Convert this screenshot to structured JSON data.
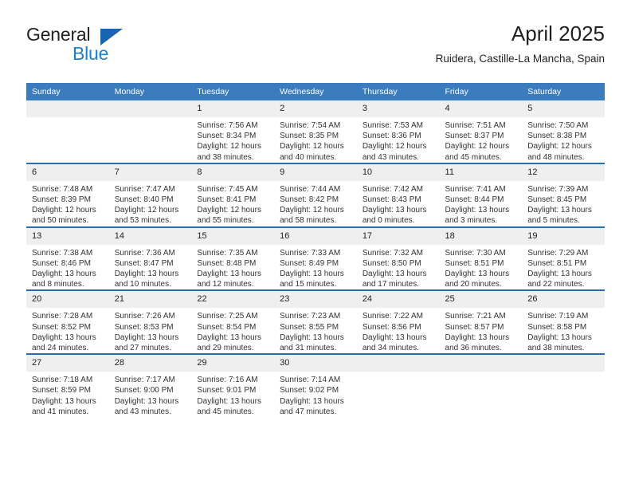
{
  "brand": {
    "line1": "General",
    "line2": "Blue",
    "triangle_icon": "triangle-logo-icon",
    "accent_dark": "#1565b0",
    "accent_light": "#1b7fd4"
  },
  "header": {
    "title": "April 2025",
    "subtitle": "Ruidera, Castille-La Mancha, Spain"
  },
  "theme": {
    "header_bar": "#3a7cbe",
    "week_separator": "#2b6cab",
    "daynum_band": "#efefef",
    "text": "#231f20"
  },
  "calendar": {
    "weekday_headers": [
      "Sunday",
      "Monday",
      "Tuesday",
      "Wednesday",
      "Thursday",
      "Friday",
      "Saturday"
    ],
    "weeks": [
      [
        {
          "day": "",
          "empty": true,
          "sunrise": "",
          "sunset": "",
          "daylight_1": "",
          "daylight_2": ""
        },
        {
          "day": "",
          "empty": true,
          "sunrise": "",
          "sunset": "",
          "daylight_1": "",
          "daylight_2": ""
        },
        {
          "day": "1",
          "empty": false,
          "sunrise": "Sunrise: 7:56 AM",
          "sunset": "Sunset: 8:34 PM",
          "daylight_1": "Daylight: 12 hours",
          "daylight_2": "and 38 minutes."
        },
        {
          "day": "2",
          "empty": false,
          "sunrise": "Sunrise: 7:54 AM",
          "sunset": "Sunset: 8:35 PM",
          "daylight_1": "Daylight: 12 hours",
          "daylight_2": "and 40 minutes."
        },
        {
          "day": "3",
          "empty": false,
          "sunrise": "Sunrise: 7:53 AM",
          "sunset": "Sunset: 8:36 PM",
          "daylight_1": "Daylight: 12 hours",
          "daylight_2": "and 43 minutes."
        },
        {
          "day": "4",
          "empty": false,
          "sunrise": "Sunrise: 7:51 AM",
          "sunset": "Sunset: 8:37 PM",
          "daylight_1": "Daylight: 12 hours",
          "daylight_2": "and 45 minutes."
        },
        {
          "day": "5",
          "empty": false,
          "sunrise": "Sunrise: 7:50 AM",
          "sunset": "Sunset: 8:38 PM",
          "daylight_1": "Daylight: 12 hours",
          "daylight_2": "and 48 minutes."
        }
      ],
      [
        {
          "day": "6",
          "empty": false,
          "sunrise": "Sunrise: 7:48 AM",
          "sunset": "Sunset: 8:39 PM",
          "daylight_1": "Daylight: 12 hours",
          "daylight_2": "and 50 minutes."
        },
        {
          "day": "7",
          "empty": false,
          "sunrise": "Sunrise: 7:47 AM",
          "sunset": "Sunset: 8:40 PM",
          "daylight_1": "Daylight: 12 hours",
          "daylight_2": "and 53 minutes."
        },
        {
          "day": "8",
          "empty": false,
          "sunrise": "Sunrise: 7:45 AM",
          "sunset": "Sunset: 8:41 PM",
          "daylight_1": "Daylight: 12 hours",
          "daylight_2": "and 55 minutes."
        },
        {
          "day": "9",
          "empty": false,
          "sunrise": "Sunrise: 7:44 AM",
          "sunset": "Sunset: 8:42 PM",
          "daylight_1": "Daylight: 12 hours",
          "daylight_2": "and 58 minutes."
        },
        {
          "day": "10",
          "empty": false,
          "sunrise": "Sunrise: 7:42 AM",
          "sunset": "Sunset: 8:43 PM",
          "daylight_1": "Daylight: 13 hours",
          "daylight_2": "and 0 minutes."
        },
        {
          "day": "11",
          "empty": false,
          "sunrise": "Sunrise: 7:41 AM",
          "sunset": "Sunset: 8:44 PM",
          "daylight_1": "Daylight: 13 hours",
          "daylight_2": "and 3 minutes."
        },
        {
          "day": "12",
          "empty": false,
          "sunrise": "Sunrise: 7:39 AM",
          "sunset": "Sunset: 8:45 PM",
          "daylight_1": "Daylight: 13 hours",
          "daylight_2": "and 5 minutes."
        }
      ],
      [
        {
          "day": "13",
          "empty": false,
          "sunrise": "Sunrise: 7:38 AM",
          "sunset": "Sunset: 8:46 PM",
          "daylight_1": "Daylight: 13 hours",
          "daylight_2": "and 8 minutes."
        },
        {
          "day": "14",
          "empty": false,
          "sunrise": "Sunrise: 7:36 AM",
          "sunset": "Sunset: 8:47 PM",
          "daylight_1": "Daylight: 13 hours",
          "daylight_2": "and 10 minutes."
        },
        {
          "day": "15",
          "empty": false,
          "sunrise": "Sunrise: 7:35 AM",
          "sunset": "Sunset: 8:48 PM",
          "daylight_1": "Daylight: 13 hours",
          "daylight_2": "and 12 minutes."
        },
        {
          "day": "16",
          "empty": false,
          "sunrise": "Sunrise: 7:33 AM",
          "sunset": "Sunset: 8:49 PM",
          "daylight_1": "Daylight: 13 hours",
          "daylight_2": "and 15 minutes."
        },
        {
          "day": "17",
          "empty": false,
          "sunrise": "Sunrise: 7:32 AM",
          "sunset": "Sunset: 8:50 PM",
          "daylight_1": "Daylight: 13 hours",
          "daylight_2": "and 17 minutes."
        },
        {
          "day": "18",
          "empty": false,
          "sunrise": "Sunrise: 7:30 AM",
          "sunset": "Sunset: 8:51 PM",
          "daylight_1": "Daylight: 13 hours",
          "daylight_2": "and 20 minutes."
        },
        {
          "day": "19",
          "empty": false,
          "sunrise": "Sunrise: 7:29 AM",
          "sunset": "Sunset: 8:51 PM",
          "daylight_1": "Daylight: 13 hours",
          "daylight_2": "and 22 minutes."
        }
      ],
      [
        {
          "day": "20",
          "empty": false,
          "sunrise": "Sunrise: 7:28 AM",
          "sunset": "Sunset: 8:52 PM",
          "daylight_1": "Daylight: 13 hours",
          "daylight_2": "and 24 minutes."
        },
        {
          "day": "21",
          "empty": false,
          "sunrise": "Sunrise: 7:26 AM",
          "sunset": "Sunset: 8:53 PM",
          "daylight_1": "Daylight: 13 hours",
          "daylight_2": "and 27 minutes."
        },
        {
          "day": "22",
          "empty": false,
          "sunrise": "Sunrise: 7:25 AM",
          "sunset": "Sunset: 8:54 PM",
          "daylight_1": "Daylight: 13 hours",
          "daylight_2": "and 29 minutes."
        },
        {
          "day": "23",
          "empty": false,
          "sunrise": "Sunrise: 7:23 AM",
          "sunset": "Sunset: 8:55 PM",
          "daylight_1": "Daylight: 13 hours",
          "daylight_2": "and 31 minutes."
        },
        {
          "day": "24",
          "empty": false,
          "sunrise": "Sunrise: 7:22 AM",
          "sunset": "Sunset: 8:56 PM",
          "daylight_1": "Daylight: 13 hours",
          "daylight_2": "and 34 minutes."
        },
        {
          "day": "25",
          "empty": false,
          "sunrise": "Sunrise: 7:21 AM",
          "sunset": "Sunset: 8:57 PM",
          "daylight_1": "Daylight: 13 hours",
          "daylight_2": "and 36 minutes."
        },
        {
          "day": "26",
          "empty": false,
          "sunrise": "Sunrise: 7:19 AM",
          "sunset": "Sunset: 8:58 PM",
          "daylight_1": "Daylight: 13 hours",
          "daylight_2": "and 38 minutes."
        }
      ],
      [
        {
          "day": "27",
          "empty": false,
          "sunrise": "Sunrise: 7:18 AM",
          "sunset": "Sunset: 8:59 PM",
          "daylight_1": "Daylight: 13 hours",
          "daylight_2": "and 41 minutes."
        },
        {
          "day": "28",
          "empty": false,
          "sunrise": "Sunrise: 7:17 AM",
          "sunset": "Sunset: 9:00 PM",
          "daylight_1": "Daylight: 13 hours",
          "daylight_2": "and 43 minutes."
        },
        {
          "day": "29",
          "empty": false,
          "sunrise": "Sunrise: 7:16 AM",
          "sunset": "Sunset: 9:01 PM",
          "daylight_1": "Daylight: 13 hours",
          "daylight_2": "and 45 minutes."
        },
        {
          "day": "30",
          "empty": false,
          "sunrise": "Sunrise: 7:14 AM",
          "sunset": "Sunset: 9:02 PM",
          "daylight_1": "Daylight: 13 hours",
          "daylight_2": "and 47 minutes."
        },
        {
          "day": "",
          "empty": true,
          "sunrise": "",
          "sunset": "",
          "daylight_1": "",
          "daylight_2": ""
        },
        {
          "day": "",
          "empty": true,
          "sunrise": "",
          "sunset": "",
          "daylight_1": "",
          "daylight_2": ""
        },
        {
          "day": "",
          "empty": true,
          "sunrise": "",
          "sunset": "",
          "daylight_1": "",
          "daylight_2": ""
        }
      ]
    ]
  }
}
